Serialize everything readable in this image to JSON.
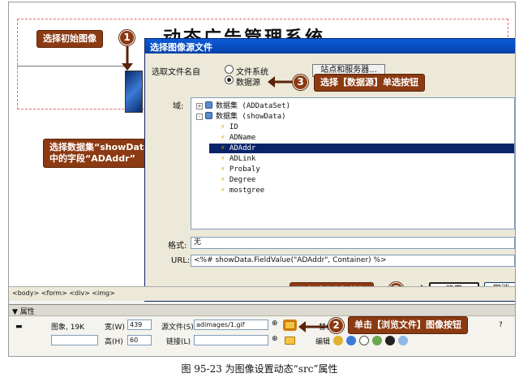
{
  "page": {
    "heading": "动态广告管理系统"
  },
  "dialog": {
    "title": "选择图像源文件",
    "select_from_label": "选取文件名自",
    "radio_filesystem": "文件系统",
    "radio_datasource": "数据源",
    "site_button": "站点和服务器...",
    "domain_label": "域:",
    "tree": [
      {
        "text": "数据集 (ADDataSet)",
        "kind": "dataset",
        "expander": "+"
      },
      {
        "text": "数据集 (showData)",
        "kind": "dataset",
        "expander": "-"
      },
      {
        "text": "ID",
        "kind": "field"
      },
      {
        "text": "ADName",
        "kind": "field"
      },
      {
        "text": "ADAddr",
        "kind": "field",
        "selected": true
      },
      {
        "text": "ADLink",
        "kind": "field"
      },
      {
        "text": "Probaly",
        "kind": "field"
      },
      {
        "text": "Degree",
        "kind": "field"
      },
      {
        "text": "mostgree",
        "kind": "field"
      }
    ],
    "format_label": "格式:",
    "format_value": "无",
    "url_label": "URL:",
    "url_value": "<%# showData.FieldValue(\"ADAddr\", Container) %>",
    "ok_label": "确定",
    "cancel_label": "取消"
  },
  "callouts": {
    "c1": {
      "num": "1",
      "text": "选择初始图像"
    },
    "c2": {
      "num": "2",
      "text": "单击【浏览文件】图像按钮"
    },
    "c3": {
      "num": "3",
      "text": "选择【数据源】单选按钮"
    },
    "c4": {
      "num": "4",
      "text": "选择数据集“showData”\n中的字段“ADAddr”"
    },
    "c5": {
      "num": "5",
      "text": "单击【确定】按钮"
    }
  },
  "tagbar": {
    "path": "<body> <form> <div> <img>"
  },
  "props": {
    "header": "▼ 属性",
    "image_info": "图象, 19K",
    "width_label": "宽(W)",
    "width_value": "439",
    "height_label": "高(H)",
    "height_value": "60",
    "src_label": "源文件(S)",
    "src_value": "adimages/1.gif",
    "link_label": "链接(L)",
    "link_value": "",
    "alt_label": "替代(T)",
    "edit_label": "编辑"
  },
  "caption": "图 95-23    为图像设置动态“src”属性",
  "colors": {
    "callout_bg": "#8b3a12",
    "dialog_title": "#0a5bd8",
    "selection": "#0a246a",
    "dashed_border": "#e06a6a"
  }
}
